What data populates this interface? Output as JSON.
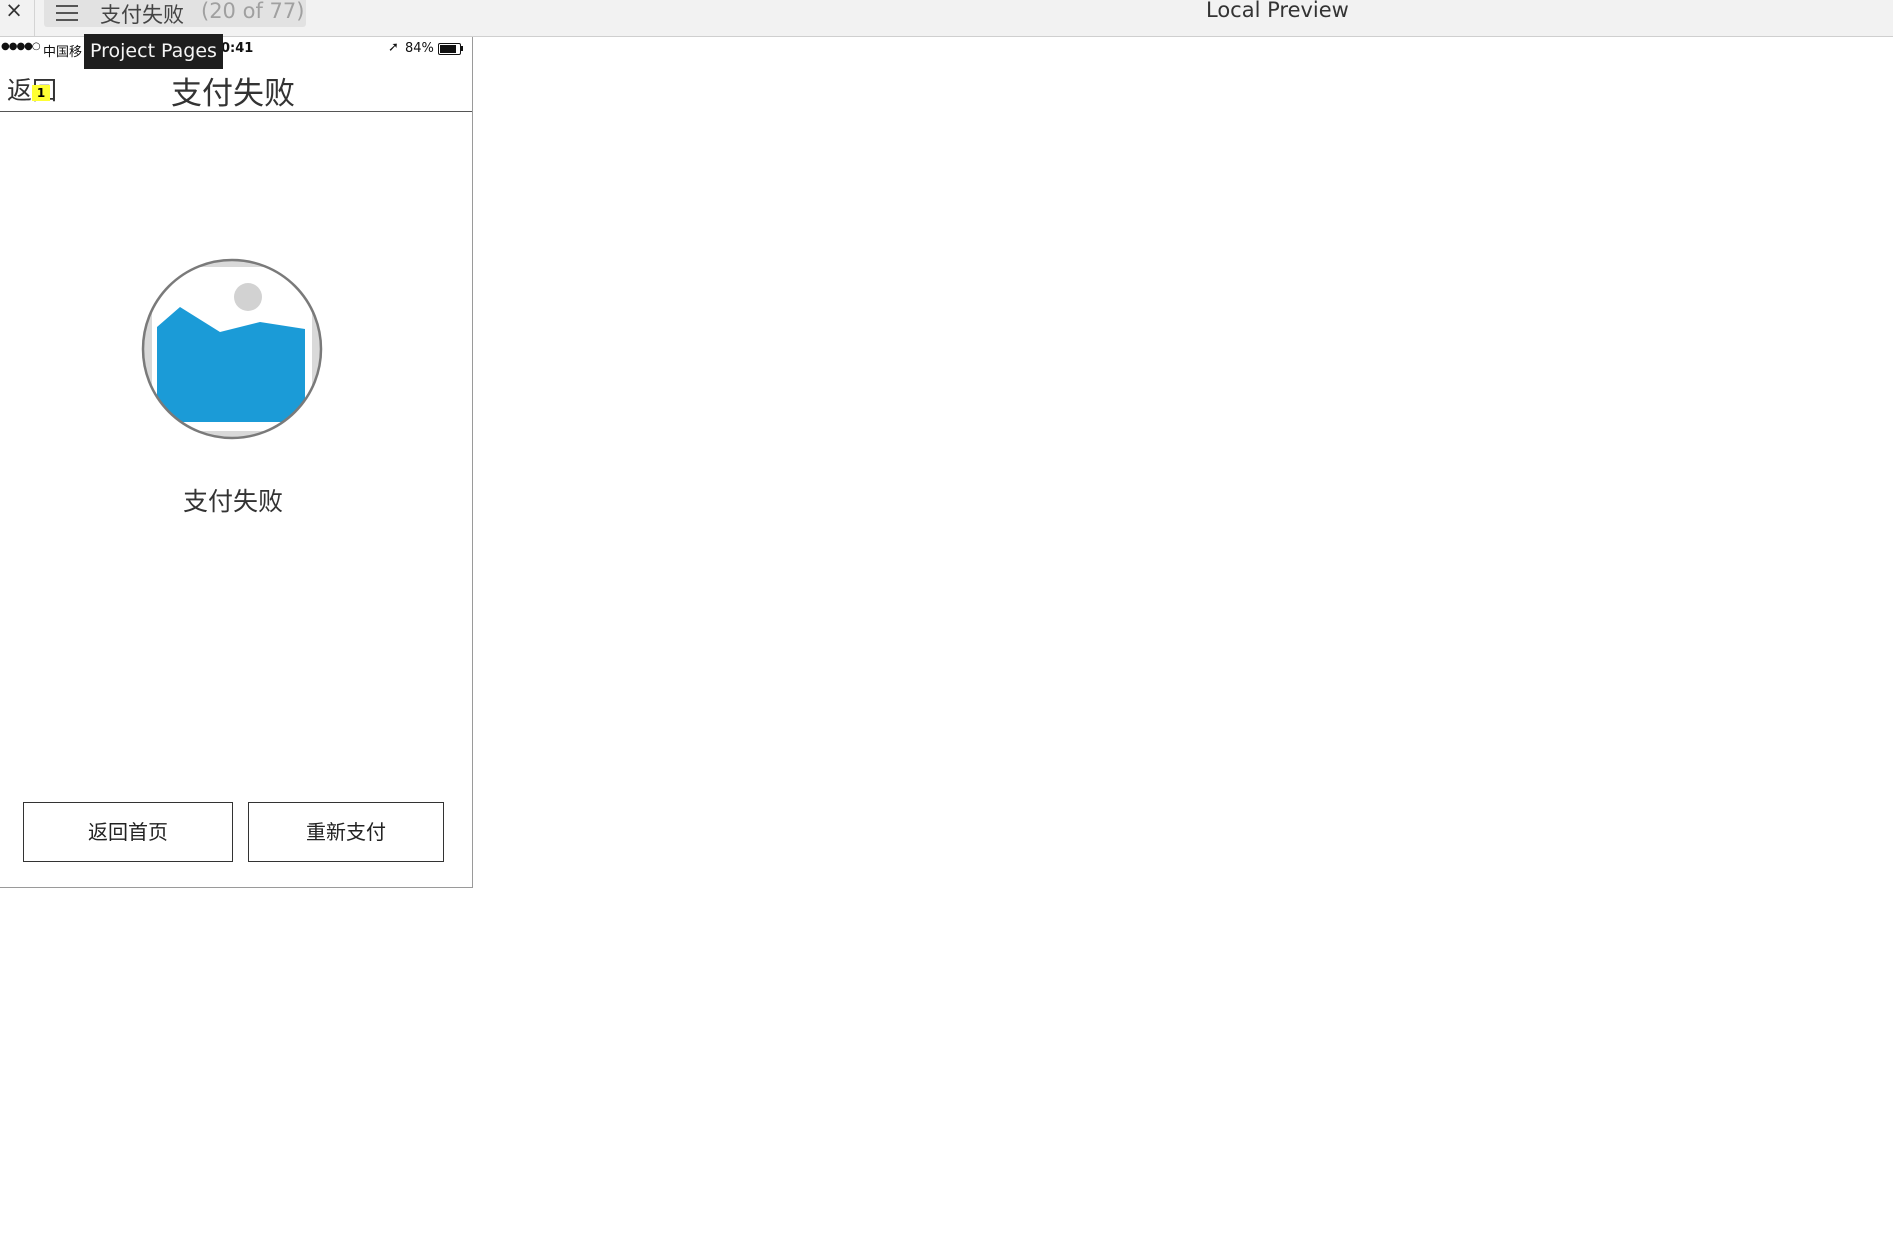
{
  "toolbar": {
    "close_label": "×",
    "page_title": "支付失败",
    "page_count": "(20 of 77)",
    "preview_label": "Local Preview",
    "menu_icon": "hamburger-icon"
  },
  "tooltip": {
    "text": "Project Pages"
  },
  "statusbar": {
    "signal": "●●●●○",
    "carrier": "中国移",
    "time": "0:41",
    "location_icon": "➚",
    "battery_text": "84%",
    "battery_level": 0.84
  },
  "navbar": {
    "back_label": "返回",
    "badge": "1",
    "title": "支付失败"
  },
  "content": {
    "image_icon": "image-placeholder-icon",
    "status_text": "支付失败"
  },
  "buttons": {
    "home_label": "返回首页",
    "retry_label": "重新支付"
  },
  "colors": {
    "accent": "#1b9bd7",
    "tooltip_bg": "#1e1e1e",
    "badge_bg": "#ffff33"
  }
}
